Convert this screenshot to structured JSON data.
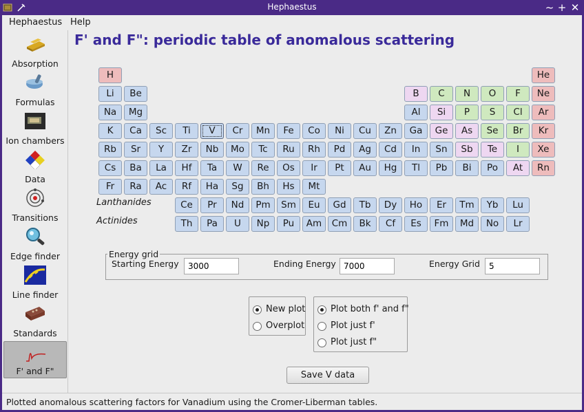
{
  "window": {
    "title": "Hephaestus"
  },
  "menu": [
    {
      "label": "Hephaestus"
    },
    {
      "label": "Help"
    }
  ],
  "sidebar": {
    "items": [
      {
        "label": "Absorption",
        "icon": "gold-bar-icon"
      },
      {
        "label": "Formulas",
        "icon": "mortar-pestle-icon"
      },
      {
        "label": "Ion chambers",
        "icon": "ion-chamber-icon"
      },
      {
        "label": "Data",
        "icon": "hazard-diamond-icon"
      },
      {
        "label": "Transitions",
        "icon": "atom-icon"
      },
      {
        "label": "Edge finder",
        "icon": "magnifier-icon"
      },
      {
        "label": "Line finder",
        "icon": "line-finder-icon"
      },
      {
        "label": "Standards",
        "icon": "standards-box-icon"
      },
      {
        "label": "F' and F\"",
        "icon": "scattering-curve-icon",
        "selected": true
      }
    ]
  },
  "main": {
    "title": "F' and F\": periodic table of anomalous scattering",
    "lanthanides_label": "Lanthanides",
    "actinides_label": "Actinides",
    "selected_element": "V"
  },
  "elements": [
    "H",
    "He",
    "Li",
    "Be",
    "B",
    "C",
    "N",
    "O",
    "F",
    "Ne",
    "Na",
    "Mg",
    "Al",
    "Si",
    "P",
    "S",
    "Cl",
    "Ar",
    "K",
    "Ca",
    "Sc",
    "Ti",
    "V",
    "Cr",
    "Mn",
    "Fe",
    "Co",
    "Ni",
    "Cu",
    "Zn",
    "Ga",
    "Ge",
    "As",
    "Se",
    "Br",
    "Kr",
    "Rb",
    "Sr",
    "Y",
    "Zr",
    "Nb",
    "Mo",
    "Tc",
    "Ru",
    "Rh",
    "Pd",
    "Ag",
    "Cd",
    "In",
    "Sn",
    "Sb",
    "Te",
    "I",
    "Xe",
    "Cs",
    "Ba",
    "La",
    "Hf",
    "Ta",
    "W",
    "Re",
    "Os",
    "Ir",
    "Pt",
    "Au",
    "Hg",
    "Tl",
    "Pb",
    "Bi",
    "Po",
    "At",
    "Rn",
    "Fr",
    "Ra",
    "Ac",
    "Rf",
    "Ha",
    "Sg",
    "Bh",
    "Hs",
    "Mt",
    "Ce",
    "Pr",
    "Nd",
    "Pm",
    "Sm",
    "Eu",
    "Gd",
    "Tb",
    "Dy",
    "Ho",
    "Er",
    "Tm",
    "Yb",
    "Lu",
    "Th",
    "Pa",
    "U",
    "Np",
    "Pu",
    "Am",
    "Cm",
    "Bk",
    "Cf",
    "Es",
    "Fm",
    "Md",
    "No",
    "Lr"
  ],
  "colors": {
    "metal": "#c6d7ee",
    "metalloid": "#eed7f1",
    "nonmetal": "#cfe9bf",
    "noble": "#eebcbc",
    "accent": "#4a2a86",
    "title": "#3a2a9a"
  },
  "energy_grid": {
    "legend": "Energy grid",
    "start_label": "Starting Energy",
    "start_value": "3000",
    "end_label": "Ending Energy",
    "end_value": "7000",
    "grid_label": "Energy Grid",
    "grid_value": "5"
  },
  "plot_mode": {
    "options": [
      {
        "label": "New plot",
        "checked": true
      },
      {
        "label": "Overplot",
        "checked": false
      }
    ]
  },
  "plot_parts": {
    "options": [
      {
        "label": "Plot both f' and f\"",
        "checked": true
      },
      {
        "label": "Plot just f'",
        "checked": false
      },
      {
        "label": "Plot just f\"",
        "checked": false
      }
    ]
  },
  "save_button": {
    "label": "Save V data"
  },
  "status": {
    "text": "Plotted anomalous scattering factors for Vanadium using the Cromer-Liberman tables."
  }
}
